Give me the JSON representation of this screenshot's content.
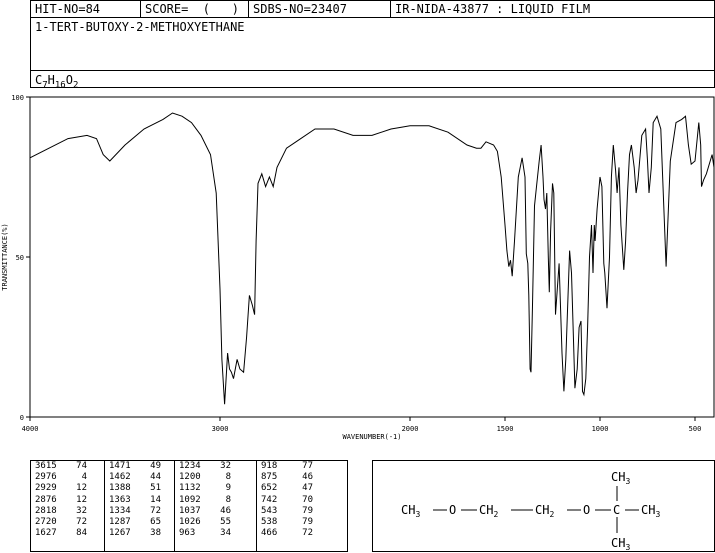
{
  "header": {
    "hit_no": "HIT-NO=84",
    "score": "SCORE=  (   )",
    "sdbs_no": "SDBS-NO=23407",
    "ir_nida": "IR-NIDA-43877 : LIQUID FILM",
    "compound_name": "1-TERT-BUTOXY-2-METHOXYETHANE",
    "formula_main": [
      "C",
      "H",
      "O"
    ],
    "formula_sub": [
      "7",
      "16",
      "2"
    ]
  },
  "chart_data": {
    "type": "line",
    "xlabel": "WAVENUMBER(-1)",
    "ylabel": "TRANSMITTANCE(%)",
    "xlim": [
      4000,
      400
    ],
    "ylim": [
      0,
      100
    ],
    "xticks": [
      4000,
      3000,
      2000,
      1500,
      1000,
      500
    ],
    "yticks": [
      0,
      50,
      100
    ],
    "x": [
      4000,
      3900,
      3800,
      3700,
      3650,
      3615,
      3580,
      3500,
      3400,
      3300,
      3250,
      3200,
      3150,
      3100,
      3050,
      3020,
      3000,
      2990,
      2976,
      2960,
      2950,
      2940,
      2929,
      2910,
      2895,
      2876,
      2860,
      2845,
      2830,
      2818,
      2810,
      2800,
      2780,
      2760,
      2740,
      2720,
      2700,
      2650,
      2600,
      2500,
      2400,
      2300,
      2200,
      2100,
      2000,
      1900,
      1800,
      1700,
      1650,
      1627,
      1600,
      1560,
      1540,
      1520,
      1500,
      1490,
      1480,
      1471,
      1462,
      1450,
      1430,
      1410,
      1395,
      1388,
      1380,
      1375,
      1368,
      1363,
      1355,
      1345,
      1334,
      1320,
      1310,
      1300,
      1295,
      1287,
      1280,
      1272,
      1267,
      1260,
      1250,
      1243,
      1234,
      1225,
      1215,
      1200,
      1190,
      1180,
      1170,
      1160,
      1150,
      1140,
      1132,
      1120,
      1110,
      1100,
      1092,
      1085,
      1075,
      1065,
      1055,
      1045,
      1037,
      1030,
      1026,
      1015,
      1000,
      990,
      980,
      975,
      963,
      950,
      940,
      930,
      918,
      910,
      900,
      890,
      875,
      865,
      855,
      845,
      835,
      820,
      810,
      800,
      780,
      760,
      750,
      742,
      730,
      720,
      700,
      680,
      652,
      630,
      600,
      570,
      550,
      543,
      535,
      520,
      500,
      480,
      470,
      466,
      455,
      440,
      420,
      410,
      400
    ],
    "y": [
      81,
      84,
      87,
      88,
      87,
      82,
      80,
      85,
      90,
      93,
      95,
      94,
      92,
      88,
      82,
      70,
      40,
      18,
      4,
      20,
      15,
      14,
      12,
      18,
      15,
      14,
      25,
      38,
      35,
      32,
      55,
      73,
      76,
      72,
      75,
      72,
      78,
      84,
      86,
      90,
      90,
      88,
      88,
      90,
      91,
      91,
      89,
      85,
      84,
      84,
      86,
      85,
      83,
      75,
      60,
      52,
      47,
      49,
      44,
      55,
      75,
      81,
      75,
      51,
      48,
      38,
      15,
      14,
      35,
      66,
      72,
      80,
      85,
      75,
      68,
      65,
      70,
      50,
      39,
      58,
      73,
      70,
      32,
      40,
      48,
      20,
      8,
      18,
      35,
      52,
      45,
      25,
      9,
      15,
      28,
      30,
      8,
      7,
      12,
      28,
      50,
      60,
      45,
      60,
      55,
      65,
      75,
      72,
      48,
      45,
      34,
      50,
      75,
      85,
      77,
      70,
      78,
      60,
      46,
      55,
      70,
      82,
      85,
      78,
      70,
      74,
      88,
      90,
      80,
      70,
      78,
      92,
      94,
      90,
      47,
      80,
      92,
      93,
      94,
      90,
      85,
      79,
      80,
      92,
      85,
      72,
      74,
      76,
      80,
      82,
      78,
      72
    ],
    "peak_table": [
      [
        [
          3615,
          74
        ],
        [
          2976,
          4
        ],
        [
          2929,
          12
        ],
        [
          2876,
          12
        ],
        [
          2818,
          32
        ],
        [
          2720,
          72
        ],
        [
          1627,
          84
        ]
      ],
      [
        [
          1471,
          49
        ],
        [
          1462,
          44
        ],
        [
          1388,
          51
        ],
        [
          1363,
          14
        ],
        [
          1334,
          72
        ],
        [
          1287,
          65
        ],
        [
          1267,
          38
        ]
      ],
      [
        [
          1234,
          32
        ],
        [
          1200,
          8
        ],
        [
          1132,
          9
        ],
        [
          1092,
          8
        ],
        [
          1037,
          46
        ],
        [
          1026,
          55
        ],
        [
          963,
          34
        ]
      ],
      [
        [
          918,
          77
        ],
        [
          875,
          46
        ],
        [
          652,
          47
        ],
        [
          742,
          70
        ],
        [
          543,
          79
        ],
        [
          538,
          79
        ],
        [
          466,
          72
        ]
      ]
    ]
  },
  "structure": {
    "left_methyl": "CH",
    "left_methyl_sub": "3",
    "oxygen1": "O",
    "ch2_a": "CH",
    "ch2_a_sub": "2",
    "ch2_b": "CH",
    "ch2_b_sub": "2",
    "oxygen2": "O",
    "quaternary_c": "C",
    "methyl_top": "CH",
    "methyl_top_sub": "3",
    "methyl_right": "CH",
    "methyl_right_sub": "3",
    "methyl_bottom": "CH",
    "methyl_bottom_sub": "3"
  }
}
